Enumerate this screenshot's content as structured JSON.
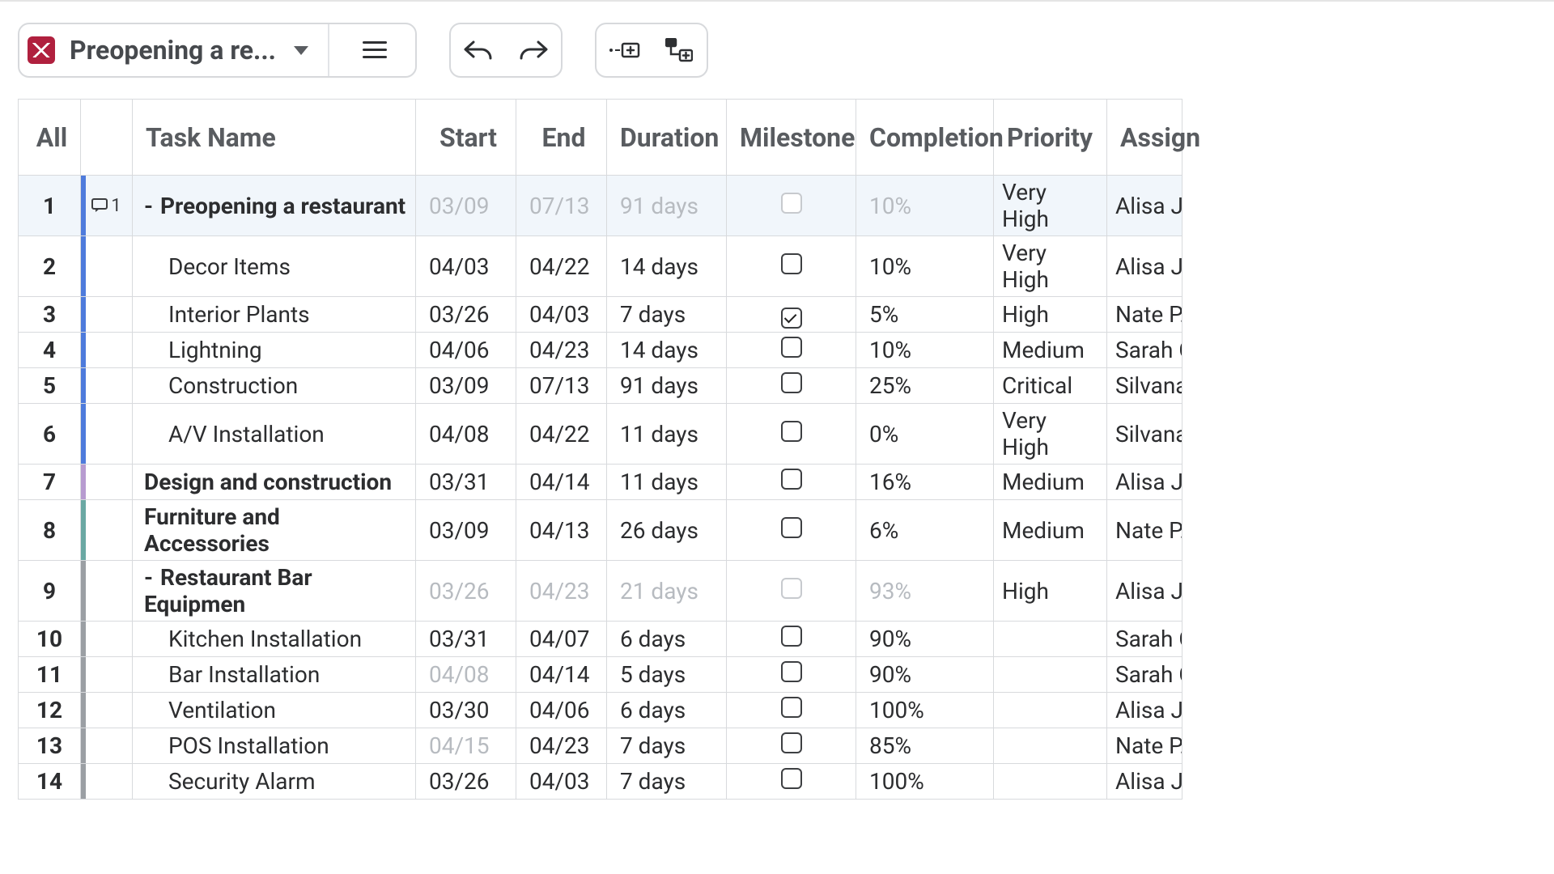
{
  "toolbar": {
    "project_title": "Preopening a re..."
  },
  "columns": {
    "all": "All",
    "task": "Task Name",
    "start": "Start",
    "end": "End",
    "duration": "Duration",
    "milestone": "Milestone",
    "completion": "Completion",
    "priority": "Priority",
    "assigned": "Assign"
  },
  "rows": [
    {
      "n": "1",
      "bar": "blue",
      "comment": "1",
      "collapse": true,
      "task": "Preopening a restaurant",
      "bold": true,
      "indent": 0,
      "start": "03/09",
      "end": "07/13",
      "dur": "91 days",
      "dim": true,
      "mile": false,
      "mile_dim": true,
      "comp": "10%",
      "comp_dim": true,
      "prio": "Very High",
      "assn": "Alisa J.",
      "selected": true
    },
    {
      "n": "2",
      "bar": "blue",
      "task": "Decor Items",
      "indent": 1,
      "start": "04/03",
      "end": "04/22",
      "dur": "14 days",
      "mile": false,
      "comp": "10%",
      "prio": "Very High",
      "assn": "Alisa J."
    },
    {
      "n": "3",
      "bar": "blue",
      "task": "Interior Plants",
      "indent": 1,
      "start": "03/26",
      "end": "04/03",
      "dur": "7 days",
      "mile": true,
      "comp": "5%",
      "prio": "High",
      "assn": "Nate P."
    },
    {
      "n": "4",
      "bar": "blue",
      "task": "Lightning",
      "indent": 1,
      "start": "04/06",
      "end": "04/23",
      "dur": "14 days",
      "mile": false,
      "comp": "10%",
      "prio": "Medium",
      "assn": "Sarah C"
    },
    {
      "n": "5",
      "bar": "blue",
      "task": "Construction",
      "indent": 1,
      "start": "03/09",
      "end": "07/13",
      "dur": "91 days",
      "mile": false,
      "comp": "25%",
      "prio": "Critical",
      "assn": "Silvana"
    },
    {
      "n": "6",
      "bar": "blue",
      "task": "A/V Installation",
      "indent": 1,
      "start": "04/08",
      "end": "04/22",
      "dur": "11 days",
      "mile": false,
      "comp": "0%",
      "prio": "Very High",
      "assn": "Silvana"
    },
    {
      "n": "7",
      "bar": "lav",
      "task": "Design and construction",
      "bold": true,
      "indent": 0,
      "start": "03/31",
      "end": "04/14",
      "dur": "11 days",
      "mile": false,
      "comp": "16%",
      "prio": "Medium",
      "assn": "Alisa J."
    },
    {
      "n": "8",
      "bar": "teal",
      "task": "Furniture and Accessories",
      "bold": true,
      "indent": 0,
      "start": "03/09",
      "end": "04/13",
      "dur": "26 days",
      "mile": false,
      "comp": "6%",
      "prio": "Medium",
      "assn": "Nate P."
    },
    {
      "n": "9",
      "bar": "grey",
      "collapse": true,
      "task": "Restaurant Bar Equipmen",
      "bold": true,
      "indent": 0,
      "start": "03/26",
      "end": "04/23",
      "dur": "21 days",
      "dim": true,
      "mile": false,
      "mile_dim": true,
      "comp": "93%",
      "comp_dim": true,
      "prio": "High",
      "assn": "Alisa J."
    },
    {
      "n": "10",
      "bar": "grey",
      "task": "Kitchen Installation",
      "indent": 1,
      "start": "03/31",
      "end": "04/07",
      "dur": "6 days",
      "mile": false,
      "comp": "90%",
      "prio": "",
      "assn": "Sarah C"
    },
    {
      "n": "11",
      "bar": "grey",
      "task": "Bar Installation",
      "indent": 1,
      "start": "04/08",
      "start_dim": true,
      "end": "04/14",
      "dur": "5 days",
      "mile": false,
      "comp": "90%",
      "prio": "",
      "assn": "Sarah C"
    },
    {
      "n": "12",
      "bar": "grey",
      "task": "Ventilation",
      "indent": 1,
      "start": "03/30",
      "end": "04/06",
      "dur": "6 days",
      "mile": false,
      "comp": "100%",
      "prio": "",
      "assn": "Alisa J."
    },
    {
      "n": "13",
      "bar": "grey",
      "task": "POS Installation",
      "indent": 1,
      "start": "04/15",
      "start_dim": true,
      "end": "04/23",
      "dur": "7 days",
      "mile": false,
      "comp": "85%",
      "prio": "",
      "assn": "Nate P."
    },
    {
      "n": "14",
      "bar": "grey",
      "task": "Security Alarm",
      "indent": 1,
      "start": "03/26",
      "end": "04/03",
      "dur": "7 days",
      "mile": false,
      "comp": "100%",
      "prio": "",
      "assn": "Alisa J."
    }
  ]
}
